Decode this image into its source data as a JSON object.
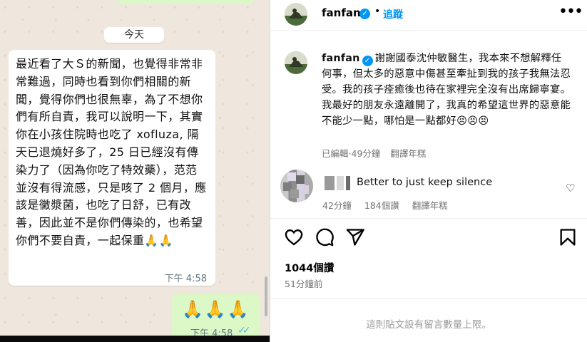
{
  "chat": {
    "date_label": "今天",
    "incoming_message": "最近看了大Ｓ的新聞，也覺得非常非常難過，同時也看到你們相關的新聞，覺得你們也很無辜，為了不想你們有所自責，我可以說明一下，其實你在小孩住院時也吃了 xofluza, 隔天已退燒好多了，25 日已經沒有傳染力了（因為你吃了特效藥），范范並沒有得流感，只是咳了 2 個月，應該是黴漿菌，也吃了日舒，已有改善，因此並不是你們傳染的，也希望你們不要自責，一起保重🙏🙏",
    "incoming_time": "下午 4:58",
    "outgoing_message": "🙏🙏🙏",
    "outgoing_time": "下午 4:58",
    "read_icon": "double-check-icon"
  },
  "instagram": {
    "header": {
      "username": "fanfan",
      "separator": "•",
      "follow_label": "追蹤",
      "more_icon": "more-horizontal-icon"
    },
    "caption": {
      "username": "fanfan",
      "text": "謝謝國泰沈仲敏醫生，我本來不想解釋任何事，但太多的惡意中傷甚至牽扯到我的孩子我無法忍受。我的孩子痊癒後也待在家裡完全沒有出席歸寧宴。我最好的朋友永遠離開了，我真的希望這世界的惡意能不能少一點，哪怕是一點都好😣😣😣",
      "edited_label": "已編輯",
      "time": "49分鐘",
      "see_translation": "翻譯年糕"
    },
    "comment": {
      "text": "Better to just keep silence",
      "time": "42分鐘",
      "likes": "184個讚",
      "see_translation": "翻譯年糕"
    },
    "actions": [
      "heart-icon",
      "comment-icon",
      "share-icon",
      "save-icon"
    ],
    "likes_count": "1044個讚",
    "posted_ago": "51分鐘前",
    "comments_limit_note": "這則貼文設有留言數量上限。",
    "colors": {
      "verified": "#0095f6",
      "follow": "#0095f6",
      "chat_out": "#dcf8c6",
      "chat_bg": "#efe7dd"
    }
  }
}
